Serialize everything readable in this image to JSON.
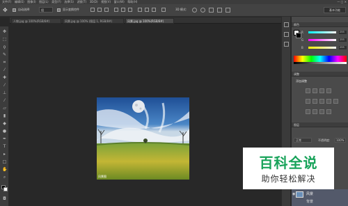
{
  "menubar": {
    "items": [
      "文件(F)",
      "编辑(E)",
      "图像(I)",
      "图层(L)",
      "类型(Y)",
      "选择(S)",
      "滤镜(T)",
      "3D(D)",
      "视图(V)",
      "窗口(W)",
      "帮助(H)"
    ]
  },
  "window_controls": "— □ ✕",
  "options": {
    "auto_select_label": "自动选择:",
    "auto_select_value": "组",
    "show_transform_label": "显示变换控件",
    "mode_3d_label": "3D 模式:",
    "workspace": "基本功能"
  },
  "tabs": [
    {
      "label": "人物.jpg @ 100%(RGB/8#)",
      "active": false
    },
    {
      "label": "风景.jpg @ 100% (图层 1, RGB/8#)",
      "active": false
    },
    {
      "label": "风景.jpg @ 100%(RGB/8#)",
      "active": true
    }
  ],
  "color_panel": {
    "header": "颜色",
    "r_label": "R",
    "g_label": "G",
    "b_label": "B",
    "r_value": "255",
    "g_value": "255",
    "b_value": "255"
  },
  "adjustments_panel": {
    "header": "调整",
    "subtitle": "添加调整"
  },
  "layers_panel": {
    "header": "图层",
    "mode": "正常",
    "opacity_label": "不透明度:",
    "opacity_value": "100%",
    "layer_name": "风景",
    "layer_sub": "背景"
  },
  "watermark": {
    "title": "百科全说",
    "subtitle": "助你轻松解决"
  },
  "photo": {
    "caption": "风景图"
  }
}
